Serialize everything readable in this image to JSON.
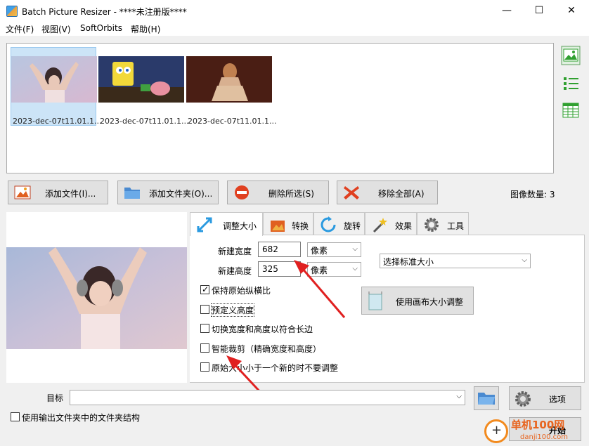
{
  "window": {
    "title": "Batch Picture Resizer - ****未注册版****",
    "minimize": "—",
    "maximize": "☐",
    "close": "✕"
  },
  "menu": [
    "文件(F)",
    "视图(V)",
    "SoftOrbits",
    "帮助(H)"
  ],
  "thumbnails": [
    {
      "label": "2023-dec-07t11.01.1..."
    },
    {
      "label": "2023-dec-07t11.01.1..."
    },
    {
      "label": "2023-dec-07t11.01.1..."
    }
  ],
  "actions": {
    "add_file": "添加文件(I)...",
    "add_folder": "添加文件夹(O)...",
    "remove_selected": "删除所选(S)",
    "remove_all": "移除全部(A)"
  },
  "image_count": "图像数量: 3",
  "tabs": [
    "调整大小",
    "转换",
    "旋转",
    "效果",
    "工具"
  ],
  "resize": {
    "width_label": "新建宽度",
    "width_value": "682",
    "width_unit": "像素",
    "height_label": "新建高度",
    "height_value": "325",
    "height_unit": "像素",
    "standard_size": "选择标准大小",
    "canvas_button": "使用画布大小调整",
    "checkboxes": [
      {
        "label": "保持原始纵横比",
        "checked": true
      },
      {
        "label": "预定义高度",
        "checked": false
      },
      {
        "label": "切换宽度和高度以符合长边",
        "checked": false
      },
      {
        "label": "智能裁剪（精确宽度和高度）",
        "checked": false
      },
      {
        "label": "原始大小小于一个新的时不要调整",
        "checked": false
      }
    ]
  },
  "bottom": {
    "target_label": "目标",
    "target_value": "",
    "options_button": "选项",
    "start_button": "开始",
    "use_folder_structure": "使用输出文件夹中的文件夹结构"
  },
  "watermark": {
    "text": "单机100网",
    "sub": "danji100.com"
  },
  "colors": {
    "accent": "#0078d7",
    "arrow": "#e02020",
    "watermark": "#e8641e"
  }
}
